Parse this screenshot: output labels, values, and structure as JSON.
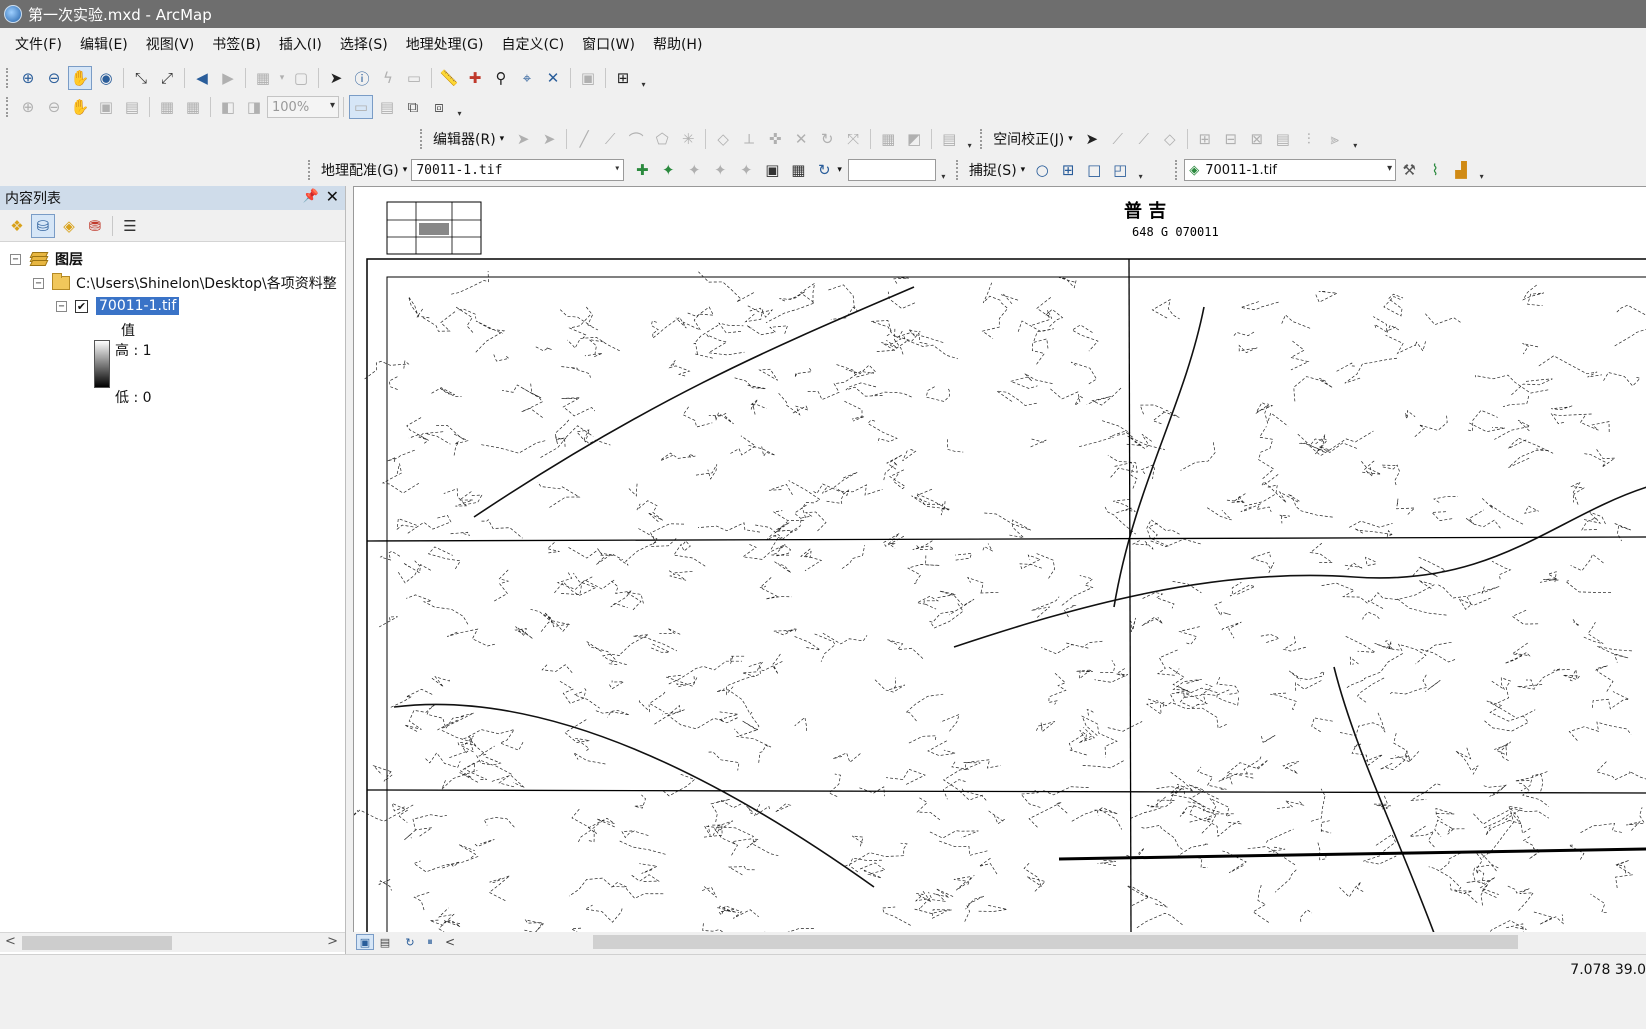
{
  "window": {
    "title": "第一次实验.mxd - ArcMap"
  },
  "menu": [
    "文件(F)",
    "编辑(E)",
    "视图(V)",
    "书签(B)",
    "插入(I)",
    "选择(S)",
    "地理处理(G)",
    "自定义(C)",
    "窗口(W)",
    "帮助(H)"
  ],
  "layout_toolbar": {
    "zoom_value": "100%"
  },
  "editor_toolbar": {
    "label": "编辑器(R)"
  },
  "spatial_adjust_toolbar": {
    "label": "空间校正(J)"
  },
  "georef_toolbar": {
    "label": "地理配准(G)",
    "layer_value": "70011-1.tif"
  },
  "snapping_toolbar": {
    "label": "捕捉(S)"
  },
  "effects_toolbar": {
    "layer_value": "70011-1.tif"
  },
  "toc": {
    "title": "内容列表",
    "root_label": "图层",
    "folder_label": "C:\\Users\\Shinelon\\Desktop\\各项资料整",
    "layer_label": "70011-1.tif",
    "layer_checked": "✔",
    "legend_heading": "值",
    "legend_high": "高 : 1",
    "legend_low": "低 : 0"
  },
  "map": {
    "sheet_name": "普    吉",
    "sheet_code": "648 G 070011"
  },
  "status": {
    "coords": "7.078  39.0"
  }
}
